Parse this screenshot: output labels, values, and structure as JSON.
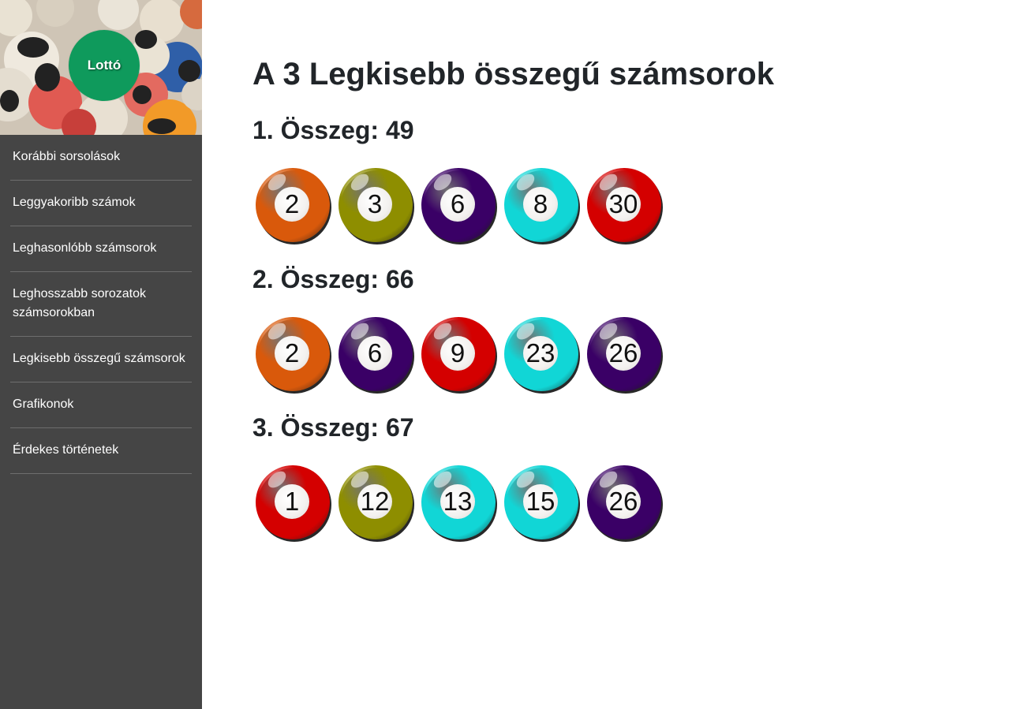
{
  "sidebar": {
    "logo_text": "Lottó",
    "items": [
      {
        "label": "Korábbi sorsolások"
      },
      {
        "label": "Leggyakoribb számok"
      },
      {
        "label": "Leghasonlóbb számsorok"
      },
      {
        "label": "Leghosszabb sorozatok számsorokban"
      },
      {
        "label": "Legkisebb összegű számsorok"
      },
      {
        "label": "Grafikonok"
      },
      {
        "label": "Érdekes történetek"
      }
    ]
  },
  "main": {
    "title": "A 3 Legkisebb összegű számsorok",
    "groups": [
      {
        "heading": "1. Összeg: 49",
        "balls": [
          {
            "number": "2",
            "color": "#d9590b"
          },
          {
            "number": "3",
            "color": "#8e8e00"
          },
          {
            "number": "6",
            "color": "#3a0066"
          },
          {
            "number": "8",
            "color": "#11d6d6"
          },
          {
            "number": "30",
            "color": "#d40000"
          }
        ]
      },
      {
        "heading": "2. Összeg: 66",
        "balls": [
          {
            "number": "2",
            "color": "#d9590b"
          },
          {
            "number": "6",
            "color": "#3a0066"
          },
          {
            "number": "9",
            "color": "#d40000"
          },
          {
            "number": "23",
            "color": "#11d6d6"
          },
          {
            "number": "26",
            "color": "#3a0066"
          }
        ]
      },
      {
        "heading": "3. Összeg: 67",
        "balls": [
          {
            "number": "1",
            "color": "#d40000"
          },
          {
            "number": "12",
            "color": "#8e8e00"
          },
          {
            "number": "13",
            "color": "#11d6d6"
          },
          {
            "number": "15",
            "color": "#11d6d6"
          },
          {
            "number": "26",
            "color": "#3a0066"
          }
        ]
      }
    ]
  }
}
